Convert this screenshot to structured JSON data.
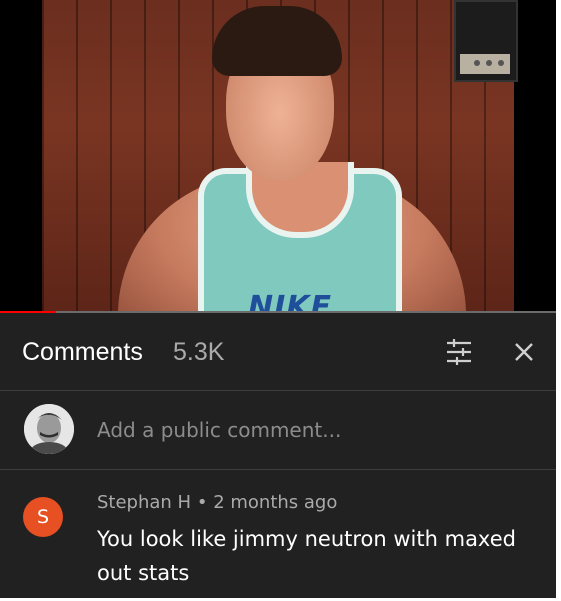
{
  "video": {
    "progress_fraction": 0.1,
    "shirt_logo": "NIKE",
    "colors": {
      "progress_played": "#ff0000",
      "progress_track": "#6b6b6b"
    }
  },
  "comments_panel": {
    "title": "Comments",
    "count": "5.3K",
    "sort_icon": "sort-sliders-icon",
    "close_icon": "close-icon",
    "add_comment": {
      "placeholder": "Add a public comment...",
      "avatar": "user-avatar"
    },
    "items": [
      {
        "avatar_letter": "S",
        "avatar_color": "#e65022",
        "author": "Stephan H",
        "separator": "•",
        "time": "2 months ago",
        "text": "You look like jimmy neutron with maxed out stats"
      }
    ]
  },
  "colors": {
    "background": "#212121",
    "divider": "#3d3d3d",
    "muted_text": "#aaaaaa"
  }
}
